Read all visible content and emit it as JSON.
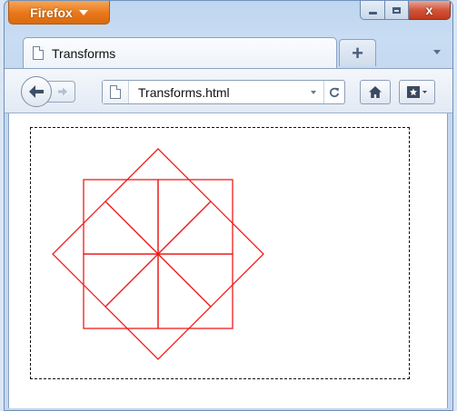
{
  "window": {
    "menu_button_label": "Firefox",
    "close_glyph": "x"
  },
  "tab": {
    "title": "Transforms",
    "new_tab_glyph": "+"
  },
  "navbar": {
    "url": "Transforms.html",
    "reload_glyph": "C"
  },
  "drawing": {
    "stroke_color": "#ee1c1c",
    "rectangle_count": 8,
    "rotation_step_degrees": 45
  }
}
